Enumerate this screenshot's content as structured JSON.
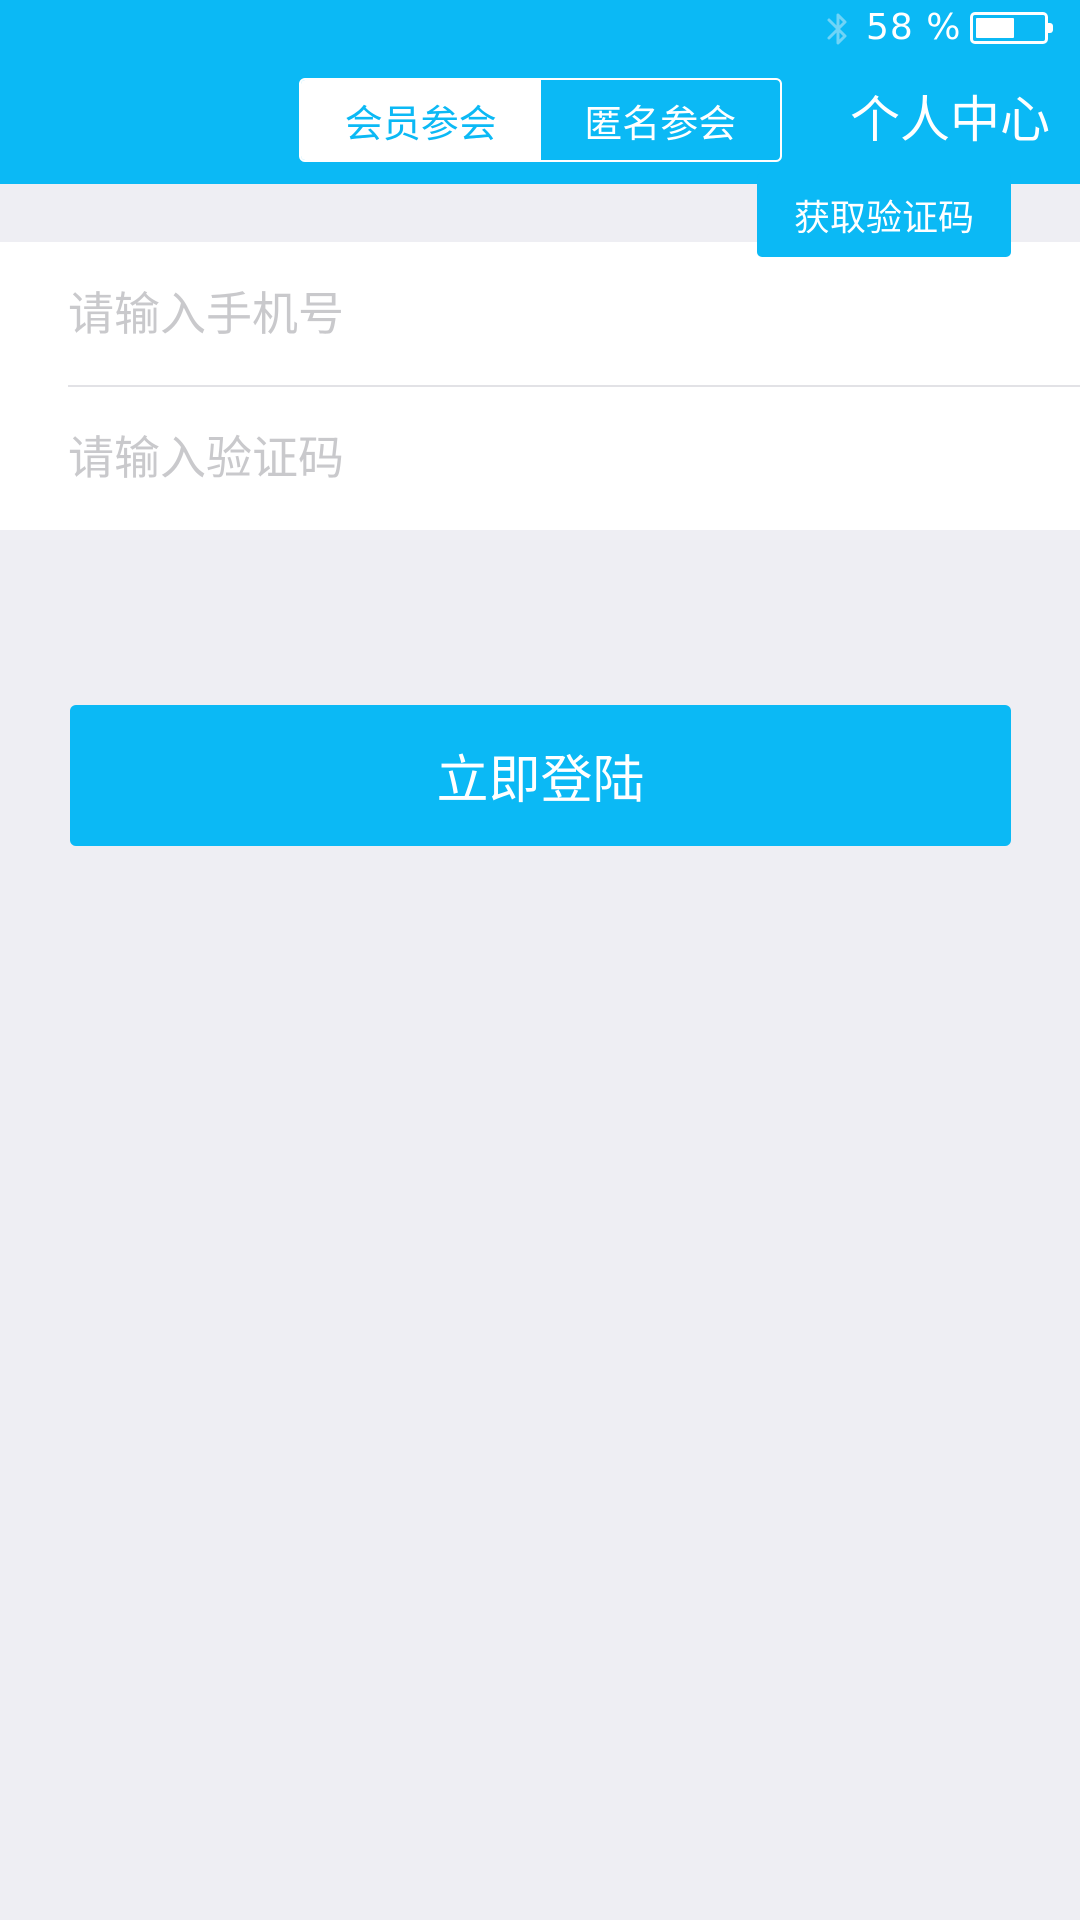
{
  "status_bar": {
    "battery_percent": "58 %",
    "battery_level": 0.58,
    "bluetooth_icon": "bluetooth-icon",
    "battery_icon": "battery-icon"
  },
  "header": {
    "tabs": [
      {
        "label": "会员参会",
        "selected": true
      },
      {
        "label": "匿名参会",
        "selected": false
      }
    ],
    "personal_center": "个人中心"
  },
  "form": {
    "phone": {
      "placeholder": "请输入手机号",
      "value": ""
    },
    "code": {
      "placeholder": "请输入验证码",
      "value": ""
    },
    "get_code_label": "获取验证码"
  },
  "login_label": "立即登陆",
  "colors": {
    "accent": "#0bb9f5",
    "background": "#eeeef3",
    "placeholder": "#c9c9cc"
  }
}
